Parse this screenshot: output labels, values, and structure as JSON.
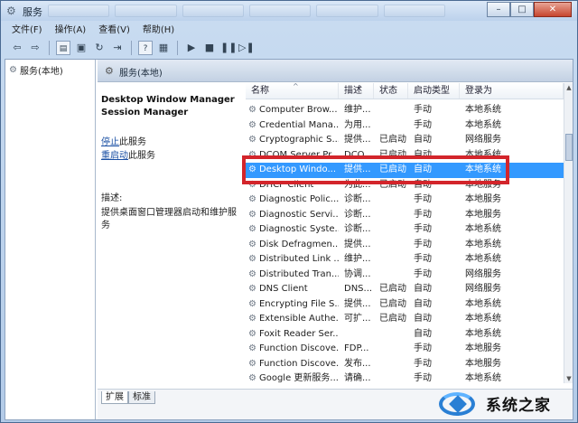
{
  "window": {
    "title": "服务",
    "buttons": {
      "minimize": "–",
      "maximize": "□",
      "close": "✕"
    }
  },
  "menu": {
    "items": [
      "文件(F)",
      "操作(A)",
      "查看(V)",
      "帮助(H)"
    ]
  },
  "tree": {
    "root": "服务(本地)"
  },
  "content": {
    "header": "服务(本地)",
    "detail": {
      "title_line1": "Desktop Window Manager",
      "title_line2": "Session Manager",
      "stop_link": "停止",
      "stop_suffix": "此服务",
      "restart_link": "重启动",
      "restart_suffix": "此服务",
      "desc_label": "描述:",
      "desc_text": "提供桌面窗口管理器启动和维护服务"
    },
    "columns": {
      "name": "名称",
      "desc": "描述",
      "status": "状态",
      "start": "启动类型",
      "logon": "登录为"
    },
    "rows": [
      {
        "name": "Computer Brow...",
        "desc": "维护...",
        "status": "",
        "start": "手动",
        "logon": "本地系统"
      },
      {
        "name": "Credential Mana...",
        "desc": "为用...",
        "status": "",
        "start": "手动",
        "logon": "本地系统"
      },
      {
        "name": "Cryptographic S...",
        "desc": "提供...",
        "status": "已启动",
        "start": "自动",
        "logon": "网络服务"
      },
      {
        "name": "DCOM Server Pr...",
        "desc": "DCO...",
        "status": "已启动",
        "start": "自动",
        "logon": "本地系统"
      },
      {
        "name": "Desktop Windo...",
        "desc": "提供...",
        "status": "已启动",
        "start": "自动",
        "logon": "本地系统",
        "selected": true
      },
      {
        "name": "DHCP Client",
        "desc": "为此...",
        "status": "已启动",
        "start": "自动",
        "logon": "本地服务"
      },
      {
        "name": "Diagnostic Polic...",
        "desc": "诊断...",
        "status": "",
        "start": "手动",
        "logon": "本地服务"
      },
      {
        "name": "Diagnostic Servi...",
        "desc": "诊断...",
        "status": "",
        "start": "手动",
        "logon": "本地服务"
      },
      {
        "name": "Diagnostic Syste...",
        "desc": "诊断...",
        "status": "",
        "start": "手动",
        "logon": "本地系统"
      },
      {
        "name": "Disk Defragmen...",
        "desc": "提供...",
        "status": "",
        "start": "手动",
        "logon": "本地系统"
      },
      {
        "name": "Distributed Link ...",
        "desc": "维护...",
        "status": "",
        "start": "手动",
        "logon": "本地系统"
      },
      {
        "name": "Distributed Tran...",
        "desc": "协调...",
        "status": "",
        "start": "手动",
        "logon": "网络服务"
      },
      {
        "name": "DNS Client",
        "desc": "DNS...",
        "status": "已启动",
        "start": "自动",
        "logon": "网络服务"
      },
      {
        "name": "Encrypting File S...",
        "desc": "提供...",
        "status": "已启动",
        "start": "自动",
        "logon": "本地系统"
      },
      {
        "name": "Extensible Authe...",
        "desc": "可扩...",
        "status": "已启动",
        "start": "自动",
        "logon": "本地系统"
      },
      {
        "name": "Foxit Reader Ser...",
        "desc": "",
        "status": "",
        "start": "自动",
        "logon": "本地系统"
      },
      {
        "name": "Function Discove...",
        "desc": "FDP...",
        "status": "",
        "start": "手动",
        "logon": "本地服务"
      },
      {
        "name": "Function Discove...",
        "desc": "发布...",
        "status": "",
        "start": "手动",
        "logon": "本地服务"
      },
      {
        "name": "Google 更新服务...",
        "desc": "请确...",
        "status": "",
        "start": "手动",
        "logon": "本地系统"
      }
    ],
    "tabs": [
      "扩展",
      "标准"
    ]
  },
  "watermark": {
    "text": "系统之家"
  }
}
